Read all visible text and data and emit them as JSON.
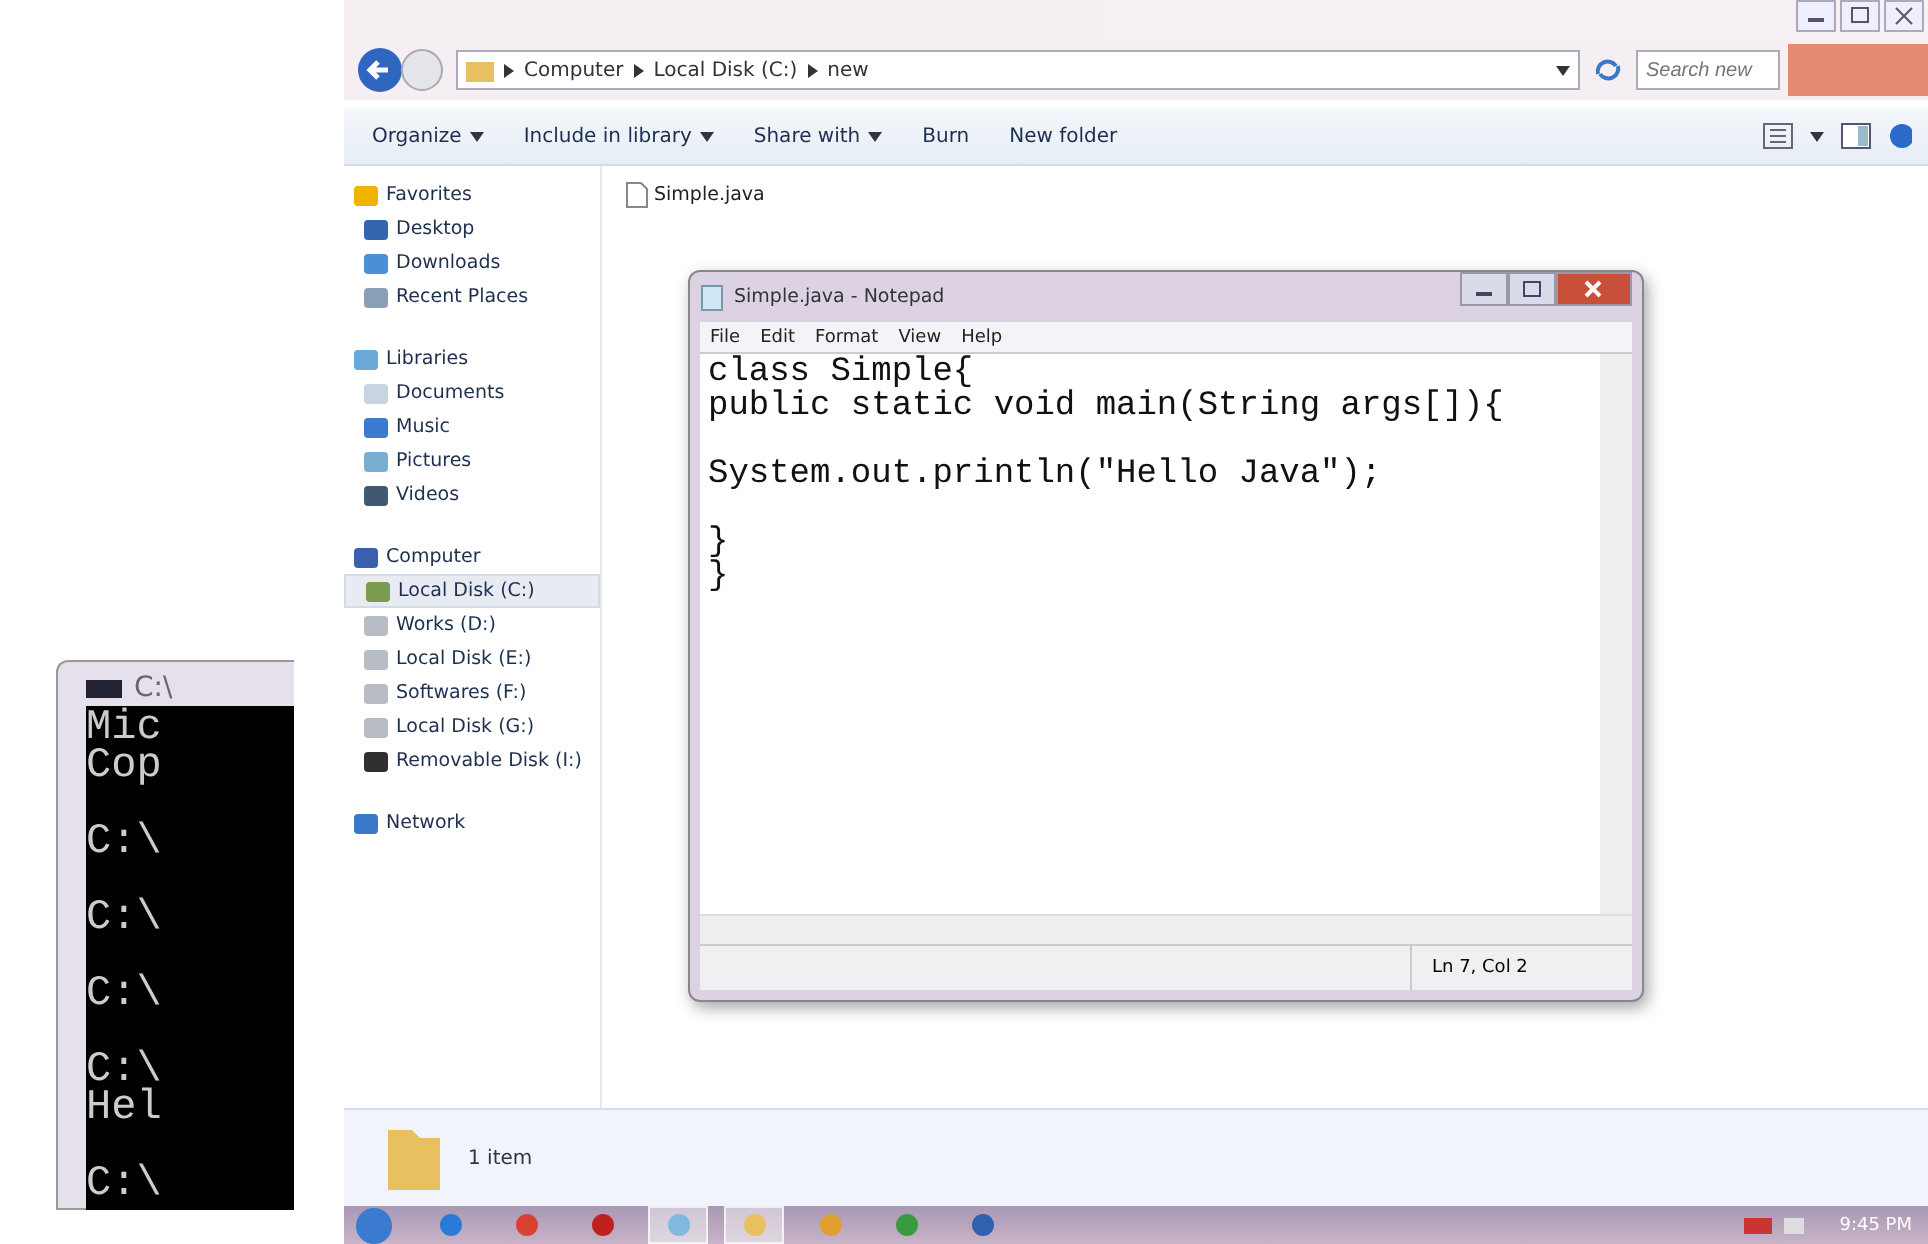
{
  "console_window": {
    "title": "C:\\",
    "blocks": [
      [
        "Mic",
        "Cop"
      ],
      [
        "C:\\"
      ],
      [
        "C:\\"
      ],
      [
        "C:\\"
      ],
      [
        "C:\\",
        "Hel"
      ],
      [
        "C:\\"
      ]
    ]
  },
  "explorer": {
    "breadcrumb": [
      "Computer",
      "Local Disk (C:)",
      "new"
    ],
    "search": {
      "placeholder": "Search new"
    },
    "toolbar": [
      {
        "label": "Organize",
        "dropdown": true
      },
      {
        "label": "Include in library",
        "dropdown": true
      },
      {
        "label": "Share with",
        "dropdown": true
      },
      {
        "label": "Burn",
        "dropdown": false
      },
      {
        "label": "New folder",
        "dropdown": false
      }
    ],
    "sidebar": {
      "groups": [
        {
          "label": "Favorites",
          "kind": "star",
          "children": [
            {
              "label": "Desktop",
              "kind": "desktop",
              "selected": false
            },
            {
              "label": "Downloads",
              "kind": "downloads",
              "selected": false
            },
            {
              "label": "Recent Places",
              "kind": "recent",
              "selected": false
            }
          ]
        },
        {
          "label": "Libraries",
          "kind": "library",
          "children": [
            {
              "label": "Documents",
              "kind": "document",
              "selected": false
            },
            {
              "label": "Music",
              "kind": "music",
              "selected": false
            },
            {
              "label": "Pictures",
              "kind": "pictures",
              "selected": false
            },
            {
              "label": "Videos",
              "kind": "videos",
              "selected": false
            }
          ]
        },
        {
          "label": "Computer",
          "kind": "computer",
          "children": [
            {
              "label": "Local Disk (C:)",
              "kind": "system-drive",
              "selected": true
            },
            {
              "label": "Works (D:)",
              "kind": "drive",
              "selected": false
            },
            {
              "label": "Local Disk (E:)",
              "kind": "drive",
              "selected": false
            },
            {
              "label": "Softwares (F:)",
              "kind": "drive",
              "selected": false
            },
            {
              "label": "Local Disk (G:)",
              "kind": "drive",
              "selected": false
            },
            {
              "label": "Removable Disk (I:)",
              "kind": "removable",
              "selected": false
            }
          ]
        },
        {
          "label": "Network",
          "kind": "network"
        }
      ]
    },
    "files": [
      "Simple.java"
    ],
    "status": "1 item"
  },
  "notepad": {
    "title": "Simple.java - Notepad",
    "menu": [
      "File",
      "Edit",
      "Format",
      "View",
      "Help"
    ],
    "code": "class Simple{\npublic static void main(String args[]){\n\nSystem.out.println(\"Hello Java\");\n\n}\n}",
    "status": "Ln 7, Col 2"
  },
  "taskbar": {
    "apps": [
      {
        "kind": "browser-e",
        "active": false
      },
      {
        "kind": "browser-ring",
        "active": false
      },
      {
        "kind": "red-app",
        "active": false
      },
      {
        "kind": "notepad",
        "active": true
      },
      {
        "kind": "folder",
        "active": true
      },
      {
        "kind": "player",
        "active": false
      },
      {
        "kind": "globe",
        "active": false
      },
      {
        "kind": "word",
        "active": false
      }
    ],
    "clock": "9:45 PM"
  }
}
